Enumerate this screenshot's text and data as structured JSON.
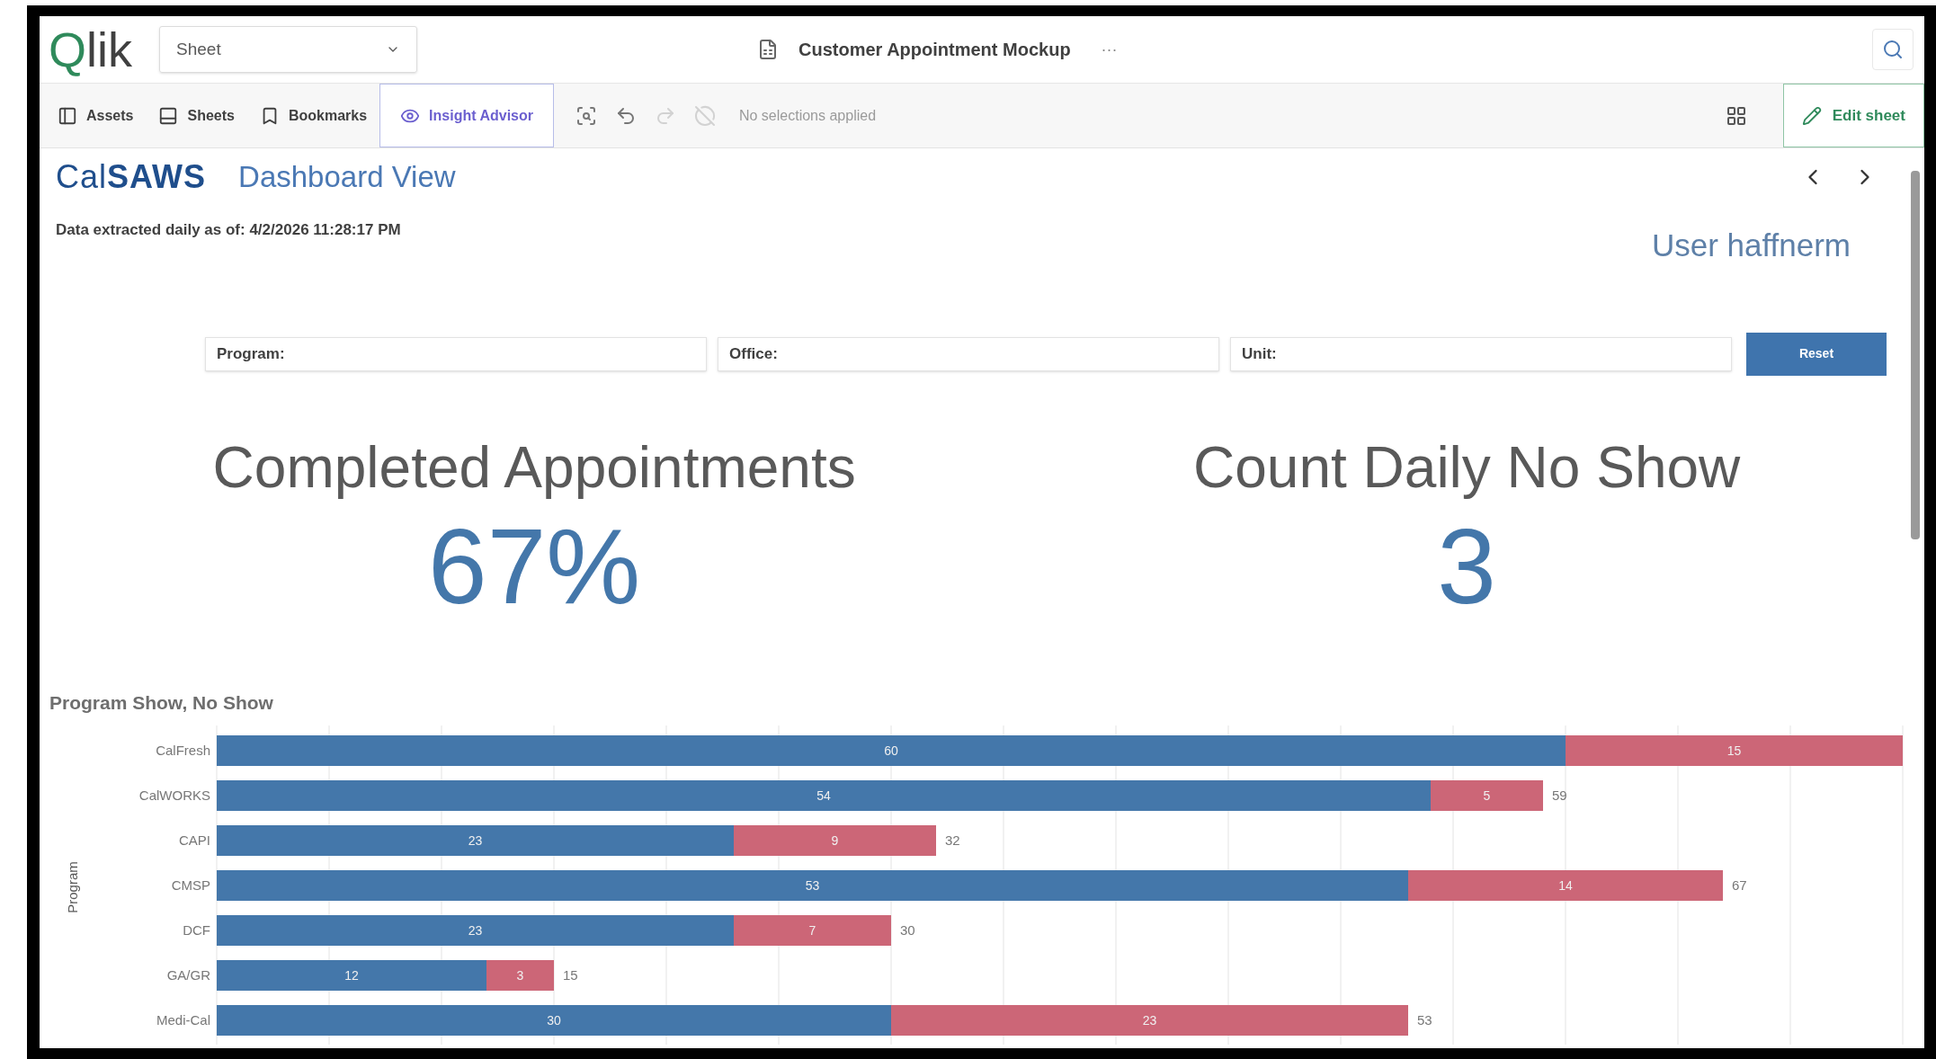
{
  "header": {
    "logo": "Qlik",
    "sheet_dropdown": "Sheet",
    "app_title": "Customer Appointment Mockup",
    "more": "···"
  },
  "toolbar": {
    "items": [
      {
        "kind": "assets",
        "label": "Assets",
        "selected": false
      },
      {
        "kind": "sheets",
        "label": "Sheets",
        "selected": false
      },
      {
        "kind": "bookmarks",
        "label": "Bookmarks",
        "selected": false
      },
      {
        "kind": "insight",
        "label": "Insight Advisor",
        "selected": true
      }
    ],
    "selection_tools": [
      {
        "kind": "search",
        "disabled": false
      },
      {
        "kind": "back",
        "disabled": false
      },
      {
        "kind": "forward",
        "disabled": true
      },
      {
        "kind": "clear",
        "disabled": true
      }
    ],
    "selections_text": "No selections applied",
    "edit_button": "Edit sheet"
  },
  "sheet": {
    "brand": "Cal**SAWS**",
    "title": "Dashboard View",
    "extracted": "Data extracted daily as of: 4/2/2026 11:28:17 PM",
    "user": "User haffnerm",
    "filters": [
      {
        "label": "Program:"
      },
      {
        "label": "Office:"
      },
      {
        "label": "Unit:"
      }
    ],
    "reset_button": "Reset",
    "kpis": [
      {
        "title": "Completed Appointments",
        "value": "67%"
      },
      {
        "title": "Count Daily No Show",
        "value": "3"
      }
    ],
    "chart": {
      "title": "Program Show, No Show",
      "chart_data": {
        "type": "bar",
        "orientation": "horizontal",
        "stacked": true,
        "ylabel": "Program",
        "xlim": [
          0,
          75
        ],
        "categories": [
          "CalFresh",
          "CalWORKS",
          "CAPI",
          "CMSP",
          "DCF",
          "GA/GR",
          "Medi-Cal"
        ],
        "series": [
          {
            "color": "#4477aa",
            "values": [
              60,
              54,
              23,
              53,
              23,
              12,
              30
            ]
          },
          {
            "color": "#cc6677",
            "values": [
              15,
              5,
              9,
              14,
              7,
              3,
              23
            ]
          }
        ],
        "data_labels": true,
        "annotations": [
          null,
          "59",
          "32",
          "67",
          "30",
          "15",
          "53"
        ]
      }
    }
  }
}
